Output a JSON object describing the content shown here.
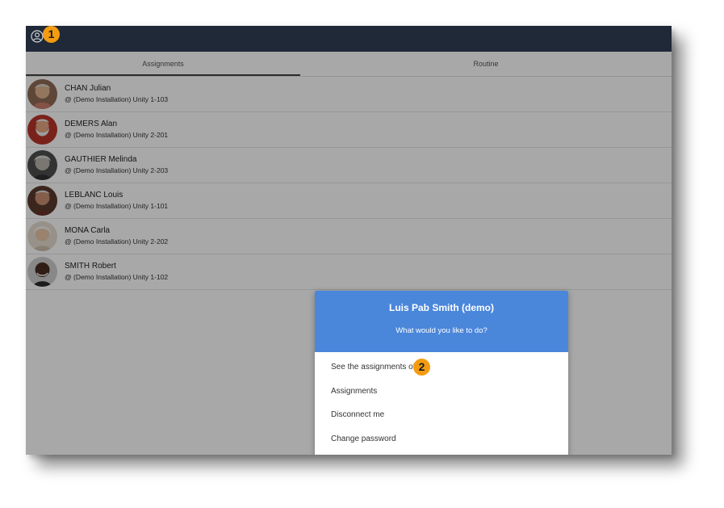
{
  "topbar": {
    "user_icon": "user-circle-icon",
    "background": "#1f2937"
  },
  "markers": {
    "first": "1",
    "second": "2",
    "color": "#f39c12"
  },
  "tabs": [
    {
      "label": "Assignments"
    },
    {
      "label": "Routine"
    }
  ],
  "residents": [
    {
      "name": "CHAN Julian",
      "location": "@ (Demo Installation) Unity 1-103",
      "avatar_color": "#b07a5a"
    },
    {
      "name": "DEMERS Alan",
      "location": "@ (Demo Installation) Unity 2-201",
      "avatar_color": "#c0392b"
    },
    {
      "name": "GAUTHIER Melinda",
      "location": "@ (Demo Installation) Unity 2-203",
      "avatar_color": "#6b6b6b"
    },
    {
      "name": "LEBLANC Louis",
      "location": "@ (Demo Installation) Unity 1-101",
      "avatar_color": "#7a4a3a"
    },
    {
      "name": "MONA Carla",
      "location": "@ (Demo Installation) Unity 2-202",
      "avatar_color": "#d9cbb8"
    },
    {
      "name": "SMITH Robert",
      "location": "@ (Demo Installation) Unity 1-102",
      "avatar_color": "#3b2a22"
    }
  ],
  "dialog": {
    "title": "Luis Pab Smith (demo)",
    "subtitle": "What would you like to do?",
    "accent": "#4a86da",
    "options": [
      {
        "label": "See the assignments of"
      },
      {
        "label": "Assignments"
      },
      {
        "label": "Disconnect me"
      },
      {
        "label": "Change password"
      }
    ]
  }
}
